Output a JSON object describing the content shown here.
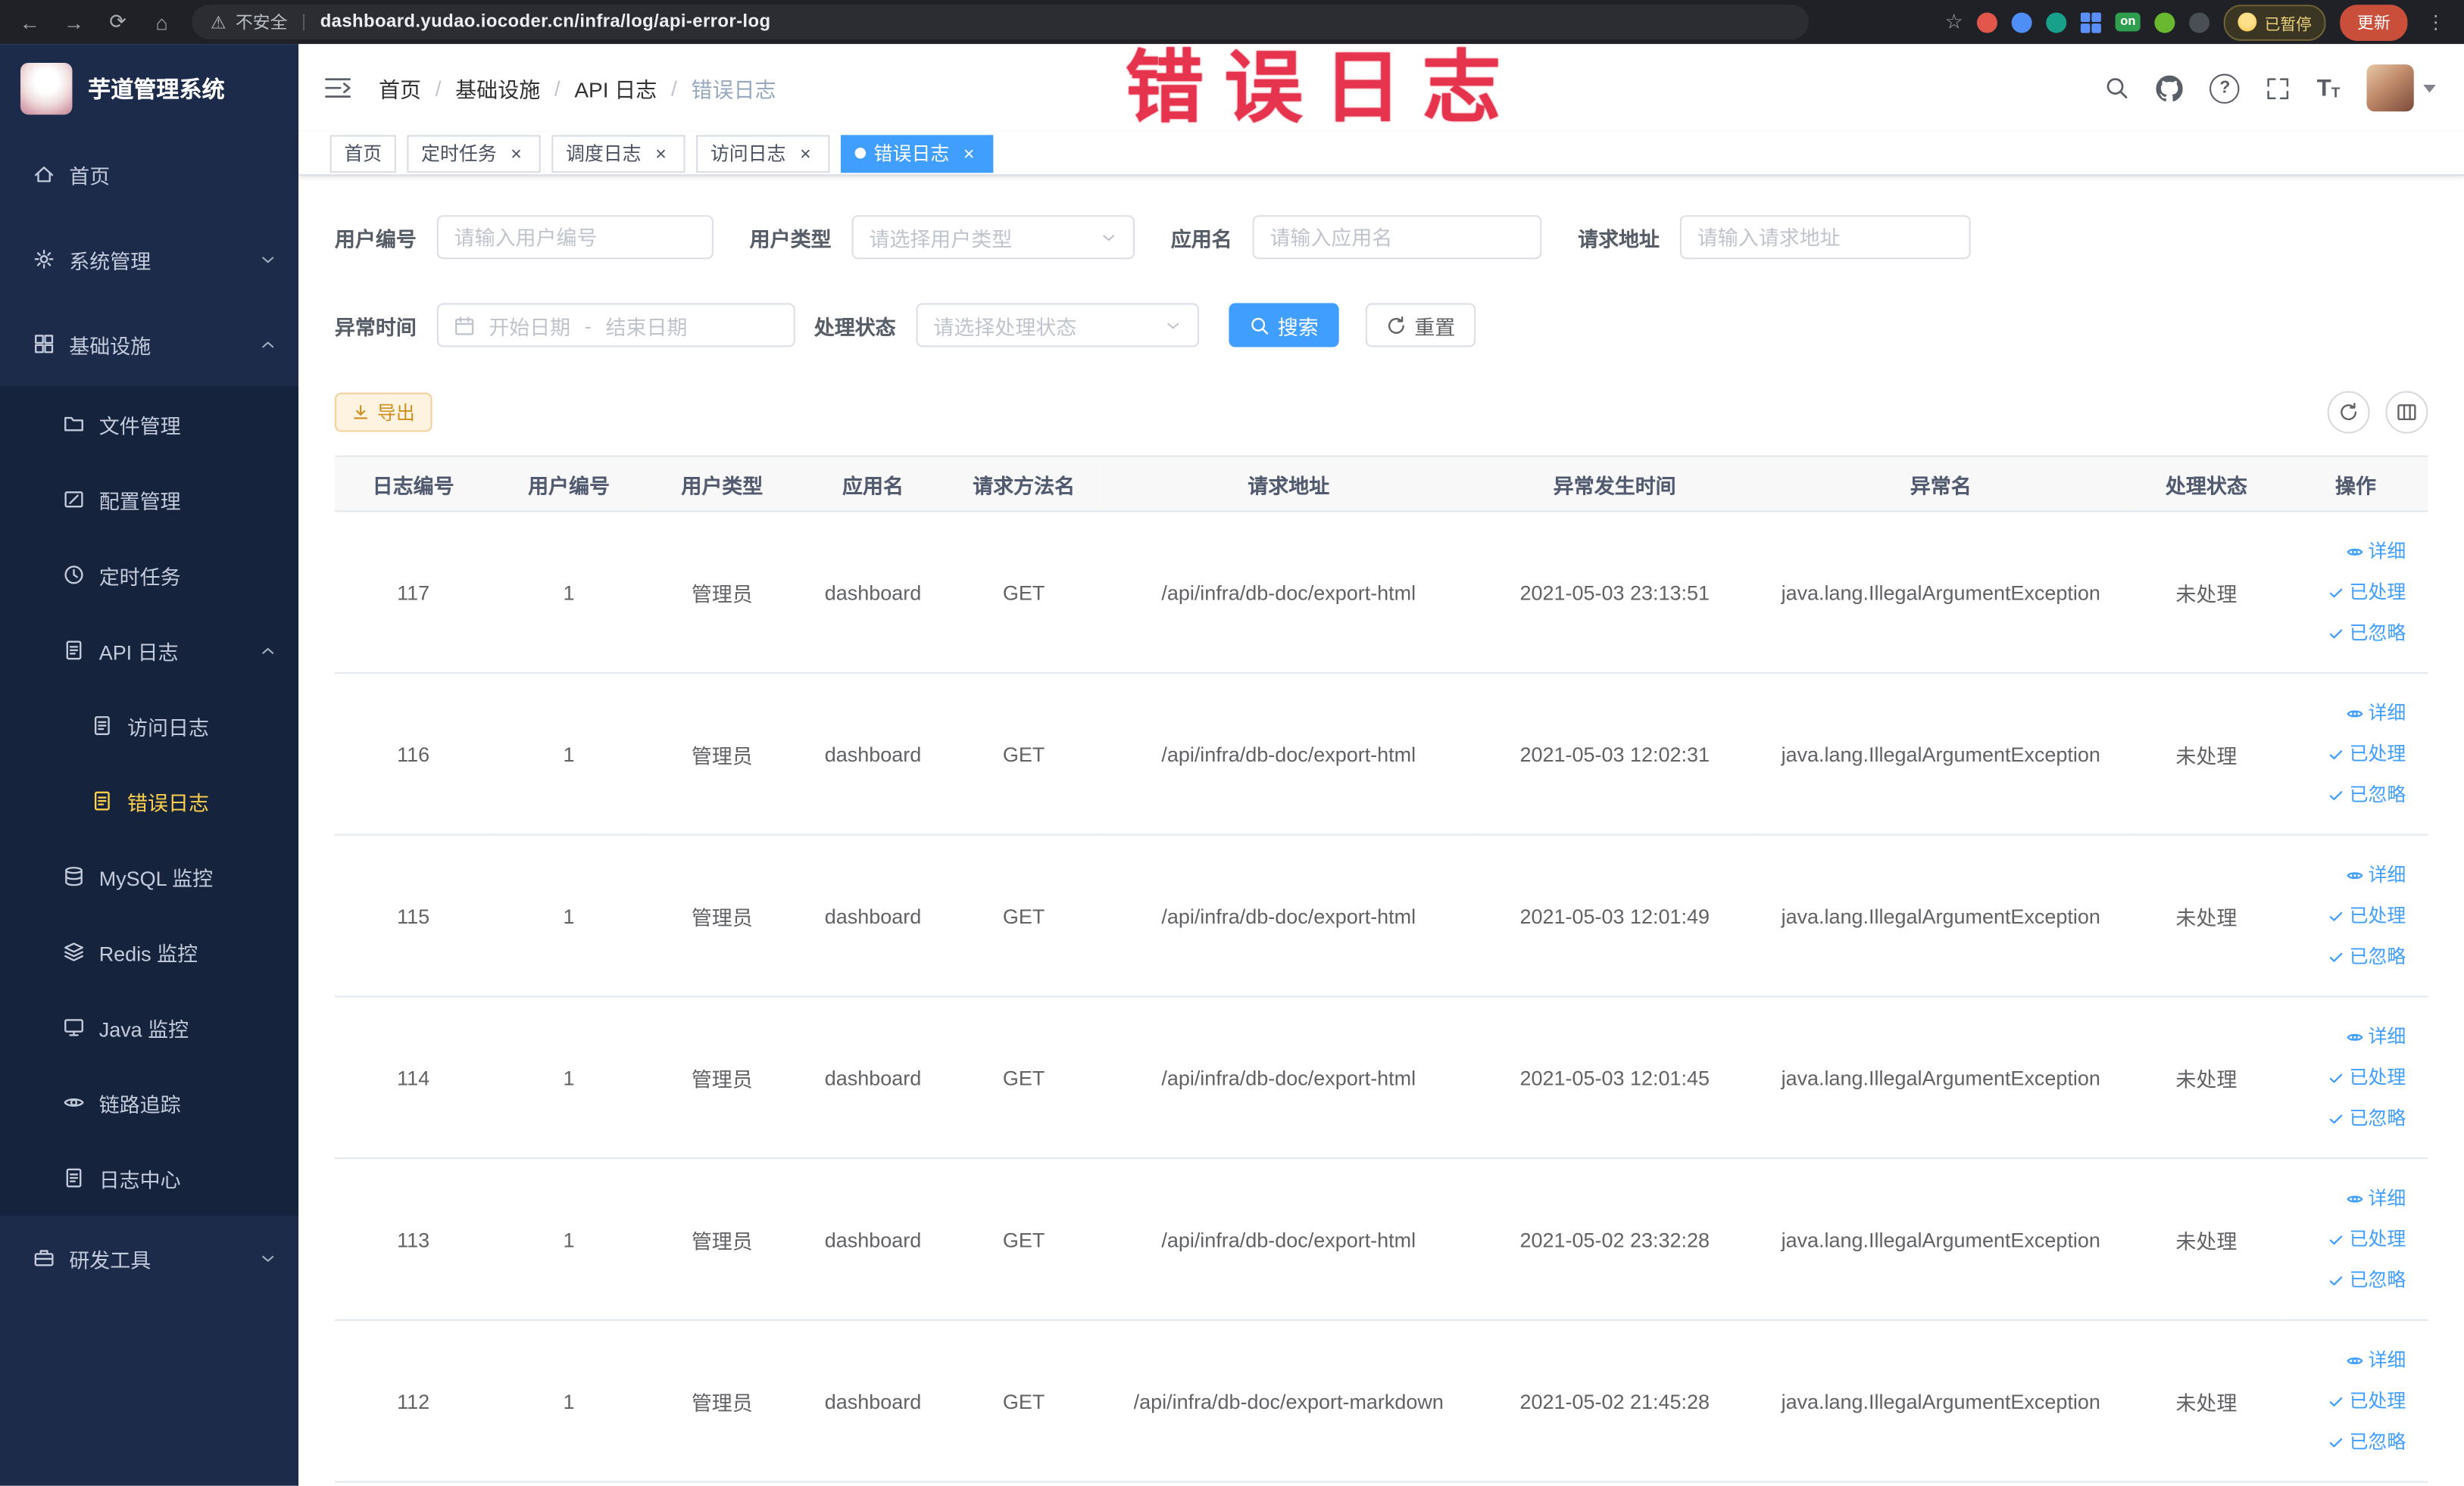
{
  "colors": {
    "primary": "#409eff",
    "sidebar_active": "#ffd04b",
    "annotation_red": "#e6344e",
    "warning": "#cf8f1e"
  },
  "browser": {
    "security_label": "不安全",
    "url": "dashboard.yudao.iocoder.cn/infra/log/api-error-log",
    "extension_on_label": "on",
    "paused_badge": "已暂停",
    "update_button": "更新"
  },
  "annotation": {
    "text": "错误日志"
  },
  "sidebar": {
    "logo_title": "芋道管理系统",
    "items": [
      {
        "label": "首页"
      },
      {
        "label": "系统管理"
      },
      {
        "label": "基础设施"
      },
      {
        "label": "文件管理"
      },
      {
        "label": "配置管理"
      },
      {
        "label": "定时任务"
      },
      {
        "label": "API 日志"
      },
      {
        "label": "访问日志"
      },
      {
        "label": "错误日志"
      },
      {
        "label": "MySQL 监控"
      },
      {
        "label": "Redis 监控"
      },
      {
        "label": "Java 监控"
      },
      {
        "label": "链路追踪"
      },
      {
        "label": "日志中心"
      },
      {
        "label": "研发工具"
      }
    ]
  },
  "header": {
    "breadcrumb": [
      "首页",
      "基础设施",
      "API 日志",
      "错误日志"
    ]
  },
  "tabs": [
    {
      "label": "首页"
    },
    {
      "label": "定时任务"
    },
    {
      "label": "调度日志"
    },
    {
      "label": "访问日志"
    },
    {
      "label": "错误日志"
    }
  ],
  "filters": {
    "user_id_label": "用户编号",
    "user_id_placeholder": "请输入用户编号",
    "user_type_label": "用户类型",
    "user_type_placeholder": "请选择用户类型",
    "app_name_label": "应用名",
    "app_name_placeholder": "请输入应用名",
    "request_url_label": "请求地址",
    "request_url_placeholder": "请输入请求地址",
    "time_label": "异常时间",
    "time_start_placeholder": "开始日期",
    "time_separator": "-",
    "time_end_placeholder": "结束日期",
    "status_label": "处理状态",
    "status_placeholder": "请选择处理状态",
    "search_label": "搜索",
    "reset_label": "重置"
  },
  "toolbar": {
    "export_label": "导出"
  },
  "table": {
    "columns": [
      "日志编号",
      "用户编号",
      "用户类型",
      "应用名",
      "请求方法名",
      "请求地址",
      "异常发生时间",
      "异常名",
      "处理状态",
      "操作"
    ],
    "actions": {
      "detail": "详细",
      "processed": "已处理",
      "ignored": "已忽略"
    },
    "rows": [
      {
        "log_id": "117",
        "user_id": "1",
        "user_type": "管理员",
        "app_name": "dashboard",
        "method": "GET",
        "url": "/api/infra/db-doc/export-html",
        "time": "2021-05-03 23:13:51",
        "exception": "java.lang.IllegalArgumentException",
        "status": "未处理"
      },
      {
        "log_id": "116",
        "user_id": "1",
        "user_type": "管理员",
        "app_name": "dashboard",
        "method": "GET",
        "url": "/api/infra/db-doc/export-html",
        "time": "2021-05-03 12:02:31",
        "exception": "java.lang.IllegalArgumentException",
        "status": "未处理"
      },
      {
        "log_id": "115",
        "user_id": "1",
        "user_type": "管理员",
        "app_name": "dashboard",
        "method": "GET",
        "url": "/api/infra/db-doc/export-html",
        "time": "2021-05-03 12:01:49",
        "exception": "java.lang.IllegalArgumentException",
        "status": "未处理"
      },
      {
        "log_id": "114",
        "user_id": "1",
        "user_type": "管理员",
        "app_name": "dashboard",
        "method": "GET",
        "url": "/api/infra/db-doc/export-html",
        "time": "2021-05-03 12:01:45",
        "exception": "java.lang.IllegalArgumentException",
        "status": "未处理"
      },
      {
        "log_id": "113",
        "user_id": "1",
        "user_type": "管理员",
        "app_name": "dashboard",
        "method": "GET",
        "url": "/api/infra/db-doc/export-html",
        "time": "2021-05-02 23:32:28",
        "exception": "java.lang.IllegalArgumentException",
        "status": "未处理"
      },
      {
        "log_id": "112",
        "user_id": "1",
        "user_type": "管理员",
        "app_name": "dashboard",
        "method": "GET",
        "url": "/api/infra/db-doc/export-markdown",
        "time": "2021-05-02 21:45:28",
        "exception": "java.lang.IllegalArgumentException",
        "status": "未处理"
      }
    ]
  }
}
